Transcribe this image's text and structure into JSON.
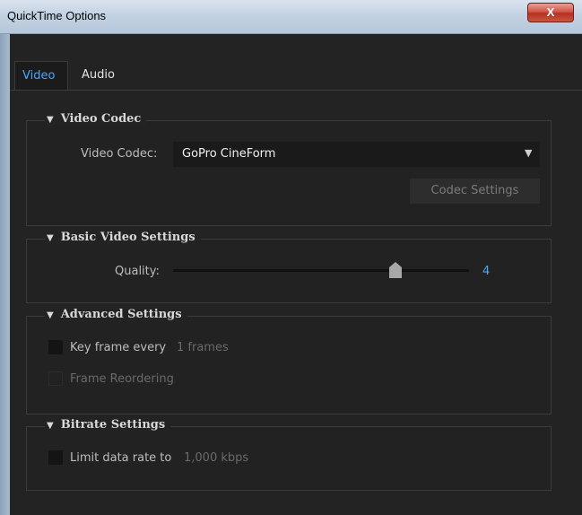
{
  "window": {
    "title": "QuickTime Options",
    "close_label": "X"
  },
  "tabs": [
    {
      "label": "Video",
      "active": true
    },
    {
      "label": "Audio",
      "active": false
    }
  ],
  "sections": {
    "video_codec": {
      "title": "Video Codec",
      "codec_label": "Video Codec:",
      "codec_value": "GoPro CineForm",
      "codec_settings_button": "Codec Settings"
    },
    "basic_video": {
      "title": "Basic Video Settings",
      "quality_label": "Quality:",
      "quality_value": "4",
      "quality_level_fraction": 0.75
    },
    "advanced": {
      "title": "Advanced Settings",
      "keyframe_label": "Key frame every",
      "keyframe_value": "1 frames",
      "reorder_label": "Frame Reordering"
    },
    "bitrate": {
      "title": "Bitrate Settings",
      "limit_label": "Limit data rate to",
      "limit_value": "1,000 kbps"
    }
  },
  "colors": {
    "accent": "#4aa6ff",
    "background": "#232323"
  },
  "icons": [
    "close-icon",
    "collapse-triangle-icon",
    "dropdown-arrow-icon",
    "slider-thumb-icon"
  ]
}
